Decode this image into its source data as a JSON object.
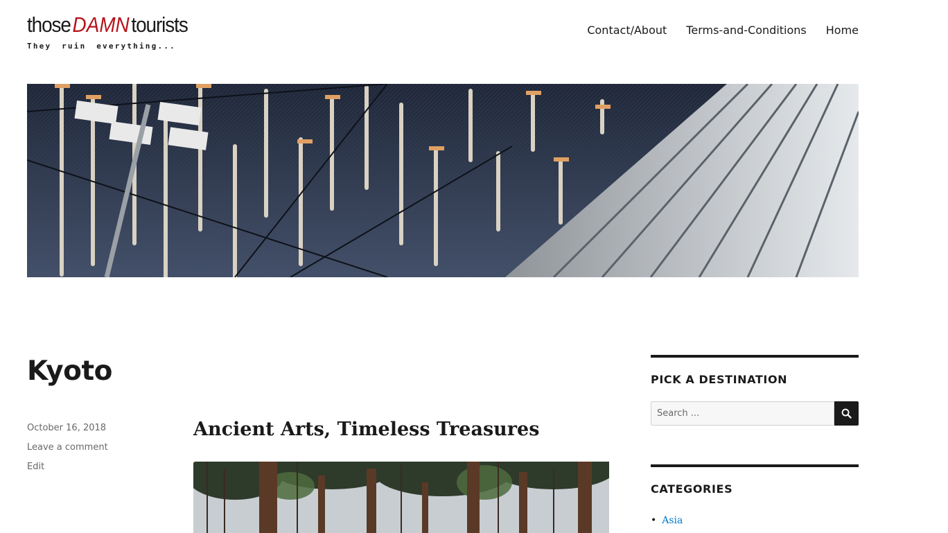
{
  "site": {
    "logo": {
      "part1": "those",
      "part2": "DAMN",
      "part3": "tourists",
      "tagline": "They ruin everything..."
    },
    "nav": [
      "Contact/About",
      "Terms-and-Conditions",
      "Home"
    ]
  },
  "post": {
    "title": "Kyoto",
    "date": "October 16, 2018",
    "comments_link": "Leave a comment",
    "edit_link": "Edit",
    "entry_title": "Ancient Arts, Timeless Treasures"
  },
  "sidebar": {
    "destination_widget": {
      "title": "PICK A DESTINATION",
      "search_placeholder": "Search ..."
    },
    "categories_widget": {
      "title": "CATEGORIES",
      "items": [
        "Asia"
      ]
    }
  },
  "colors": {
    "accent_link": "#007acc",
    "logo_red": "#b5121b",
    "text": "#1a1a1a",
    "meta": "#686868"
  }
}
